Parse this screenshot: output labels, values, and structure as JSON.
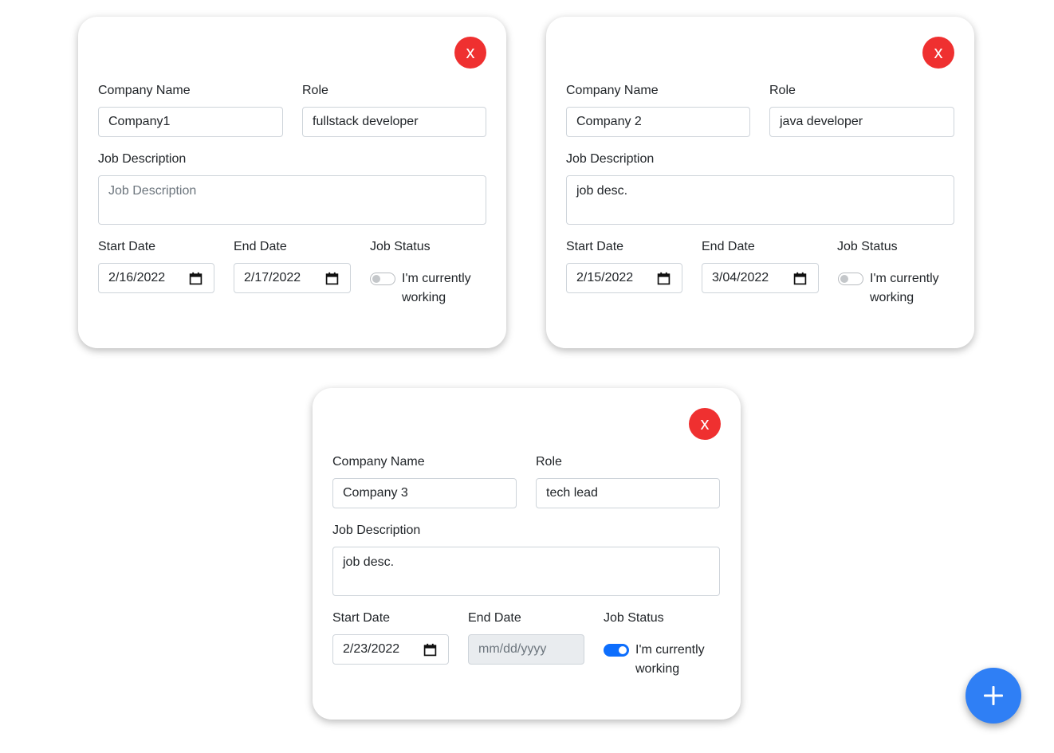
{
  "labels": {
    "company_name": "Company Name",
    "role": "Role",
    "job_description": "Job Description",
    "start_date": "Start Date",
    "end_date": "End Date",
    "job_status": "Job Status",
    "currently_working": "I'm currently working",
    "close": "x"
  },
  "placeholders": {
    "job_description": "Job Description",
    "date": "mm/dd/yyyy"
  },
  "cards": [
    {
      "company": "Company1",
      "role": "fullstack developer",
      "description": "",
      "start_date": "2/16/2022",
      "end_date": "2/17/2022",
      "currently_working": false
    },
    {
      "company": "Company 2",
      "role": "java developer",
      "description": "job desc.",
      "start_date": "2/15/2022",
      "end_date": "3/04/2022",
      "currently_working": false
    },
    {
      "company": "Company 3",
      "role": "tech lead",
      "description": "job desc.",
      "start_date": "2/23/2022",
      "end_date": "",
      "currently_working": true
    }
  ],
  "colors": {
    "close": "#ef3030",
    "accent": "#0d6efd",
    "fab": "#2f7ff5"
  },
  "icons": {
    "close": "x-glyph",
    "add": "plus-icon",
    "calendar": "calendar-icon"
  }
}
